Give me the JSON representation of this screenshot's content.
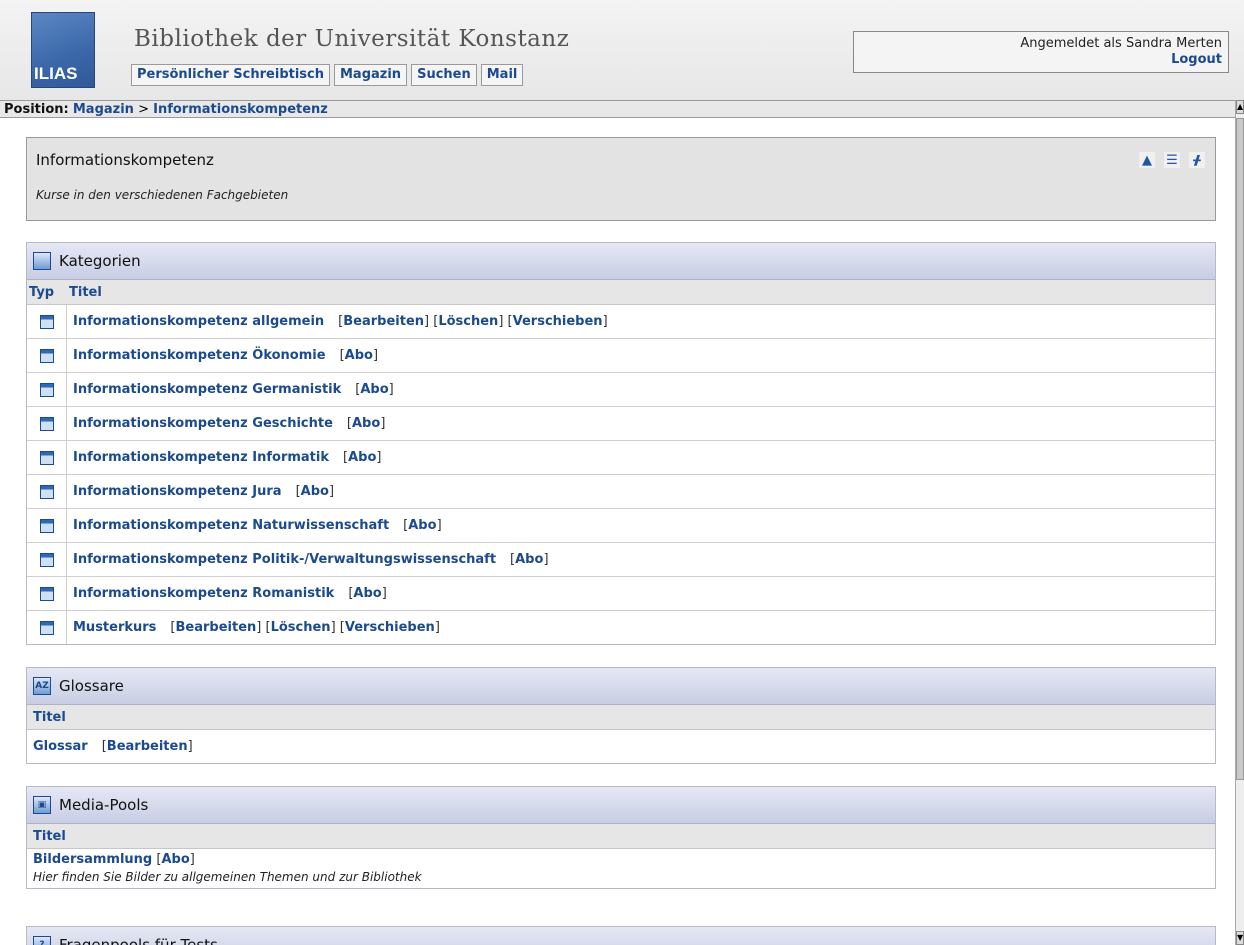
{
  "header": {
    "logo_text": "ILIAS",
    "site_title": "Bibliothek der Universität Konstanz",
    "nav": [
      "Persönlicher Schreibtisch",
      "Magazin",
      "Suchen",
      "Mail"
    ],
    "user_text": "Angemeldet als Sandra Merten",
    "logout_label": "Logout"
  },
  "position": {
    "label": "Position:",
    "crumb1": "Magazin",
    "sep": ">",
    "crumb2": "Informationskompetenz"
  },
  "info": {
    "title": "Informationskompetenz",
    "description": "Kurse in den verschiedenen Fachgebieten"
  },
  "kategorien": {
    "header": "Kategorien",
    "col_typ": "Typ",
    "col_titel": "Titel",
    "rows": [
      {
        "title": "Informationskompetenz allgemein",
        "a1": "Bearbeiten",
        "a2": "Löschen",
        "a3": "Verschieben"
      },
      {
        "title": "Informationskompetenz Ökonomie",
        "a1": "Abo"
      },
      {
        "title": "Informationskompetenz Germanistik",
        "a1": "Abo"
      },
      {
        "title": "Informationskompetenz Geschichte",
        "a1": "Abo"
      },
      {
        "title": "Informationskompetenz Informatik",
        "a1": "Abo"
      },
      {
        "title": "Informationskompetenz Jura",
        "a1": "Abo"
      },
      {
        "title": "Informationskompetenz Naturwissenschaft",
        "a1": "Abo"
      },
      {
        "title": "Informationskompetenz Politik-/Verwaltungswissenschaft",
        "a1": "Abo"
      },
      {
        "title": "Informationskompetenz Romanistik",
        "a1": "Abo"
      },
      {
        "title": "Musterkurs",
        "a1": "Bearbeiten",
        "a2": "Löschen",
        "a3": "Verschieben"
      }
    ]
  },
  "glossare": {
    "header": "Glossare",
    "col_titel": "Titel",
    "row": {
      "title": "Glossar",
      "a1": "Bearbeiten"
    }
  },
  "mediapools": {
    "header": "Media-Pools",
    "col_titel": "Titel",
    "row": {
      "title": "Bildersammlung",
      "a1": "Abo",
      "desc": "Hier finden Sie Bilder zu allgemeinen Themen und zur Bibliothek"
    }
  },
  "fragepools": {
    "header": "Fragenpools für Tests"
  },
  "colors": {
    "link": "#1c4a8f",
    "block_header": "#c8cde4"
  }
}
